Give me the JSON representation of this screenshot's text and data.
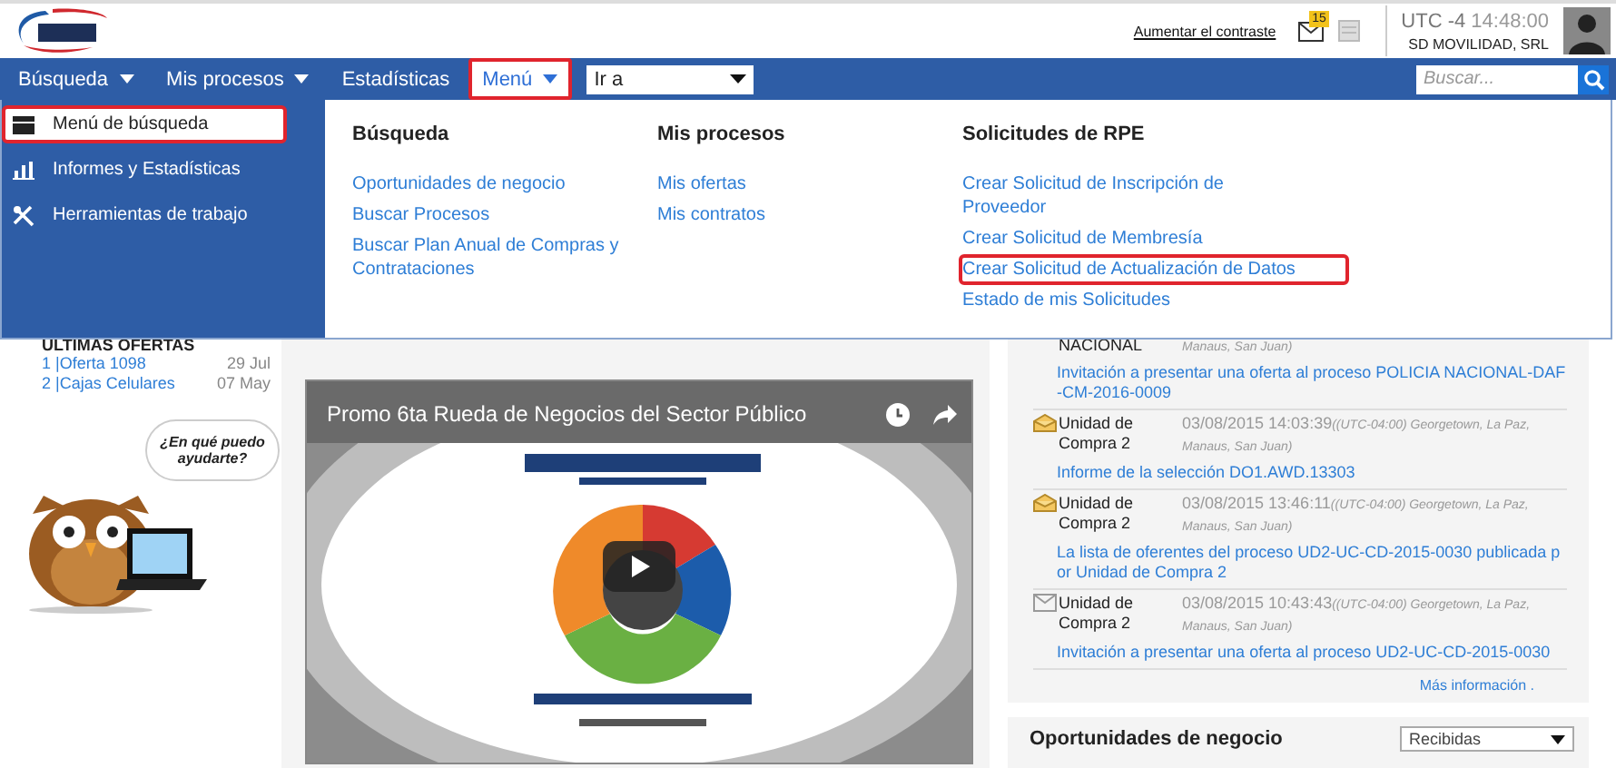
{
  "header": {
    "contrast_link": "Aumentar el contraste",
    "mail_count": "15",
    "timezone": "UTC -4",
    "time": "14:48:00",
    "company": "SD MOVILIDAD, SRL"
  },
  "nav": {
    "items": [
      {
        "label": "Búsqueda",
        "caret": true,
        "highlighted": false
      },
      {
        "label": "Mis procesos",
        "caret": true,
        "highlighted": false
      },
      {
        "label": "Estadísticas",
        "caret": false,
        "highlighted": false
      },
      {
        "label": "Menú",
        "caret": true,
        "highlighted": true
      }
    ],
    "goto": "Ir a",
    "search": {
      "placeholder": "Buscar..."
    }
  },
  "menu": {
    "sidebar": [
      {
        "label": "Menú de búsqueda",
        "kind": "box",
        "selected": true
      },
      {
        "label": "Informes y Estadísticas",
        "kind": "bars",
        "selected": false
      },
      {
        "label": "Herramientas de trabajo",
        "kind": "tools",
        "selected": false
      }
    ],
    "columns": [
      {
        "title": "Búsqueda",
        "links": [
          {
            "label": "Oportunidades de negocio",
            "highlighted": false
          },
          {
            "label": "Buscar Procesos",
            "highlighted": false
          },
          {
            "label": "Buscar Plan Anual de Compras y Contrataciones",
            "highlighted": false
          }
        ]
      },
      {
        "title": "Mis procesos",
        "links": [
          {
            "label": "Mis ofertas",
            "highlighted": false
          },
          {
            "label": "Mis contratos",
            "highlighted": false
          }
        ]
      },
      {
        "title": "Solicitudes de RPE",
        "links": [
          {
            "label": "Crear Solicitud de Inscripción de Proveedor",
            "highlighted": false
          },
          {
            "label": "Crear Solicitud de Membresía",
            "highlighted": false
          },
          {
            "label": "Crear Solicitud de Actualización de Datos",
            "highlighted": true
          },
          {
            "label": "Estado de mis Solicitudes",
            "highlighted": false
          }
        ]
      }
    ]
  },
  "offers": {
    "title": "ULTIMAS OFERTAS",
    "rows": [
      {
        "label": "1 |Oferta 1098",
        "date": "29 Jul"
      },
      {
        "label": "2 |Cajas Celulares",
        "date": "07 May"
      }
    ]
  },
  "assistant": {
    "bubble": "¿En qué puedo ayudarte?"
  },
  "video": {
    "title": "Promo 6ta Rueda de Negocios del Sector Público"
  },
  "notifications": {
    "items": [
      {
        "sender": "NACIONAL",
        "timezone": "Manaus, San Juan)",
        "link": "Invitación a presentar una oferta al proceso POLICIA NACIONAL-DAF-CM-2016-0009"
      },
      {
        "sender": "Unidad de Compra 2",
        "date": "03/08/2015 14:03:39",
        "timezone": "((UTC-04:00) Georgetown, La Paz, Manaus, San Juan)",
        "link": "Informe de la selección DO1.AWD.13303",
        "read": true
      },
      {
        "sender": "Unidad de Compra 2",
        "date": "03/08/2015 13:46:11",
        "timezone": "((UTC-04:00) Georgetown, La Paz, Manaus, San Juan)",
        "link": "La lista de oferentes del proceso UD2-UC-CD-2015-0030 publicada por Unidad de Compra 2",
        "read": true
      },
      {
        "sender": "Unidad de Compra 2",
        "date": "03/08/2015 10:43:43",
        "timezone": "((UTC-04:00) Georgetown, La Paz, Manaus, San Juan)",
        "link": "Invitación a presentar una oferta al proceso UD2-UC-CD-2015-0030",
        "read": false
      }
    ],
    "more": "Más información ."
  },
  "opportunities": {
    "title": "Oportunidades de negocio",
    "filter": "Recibidas"
  }
}
